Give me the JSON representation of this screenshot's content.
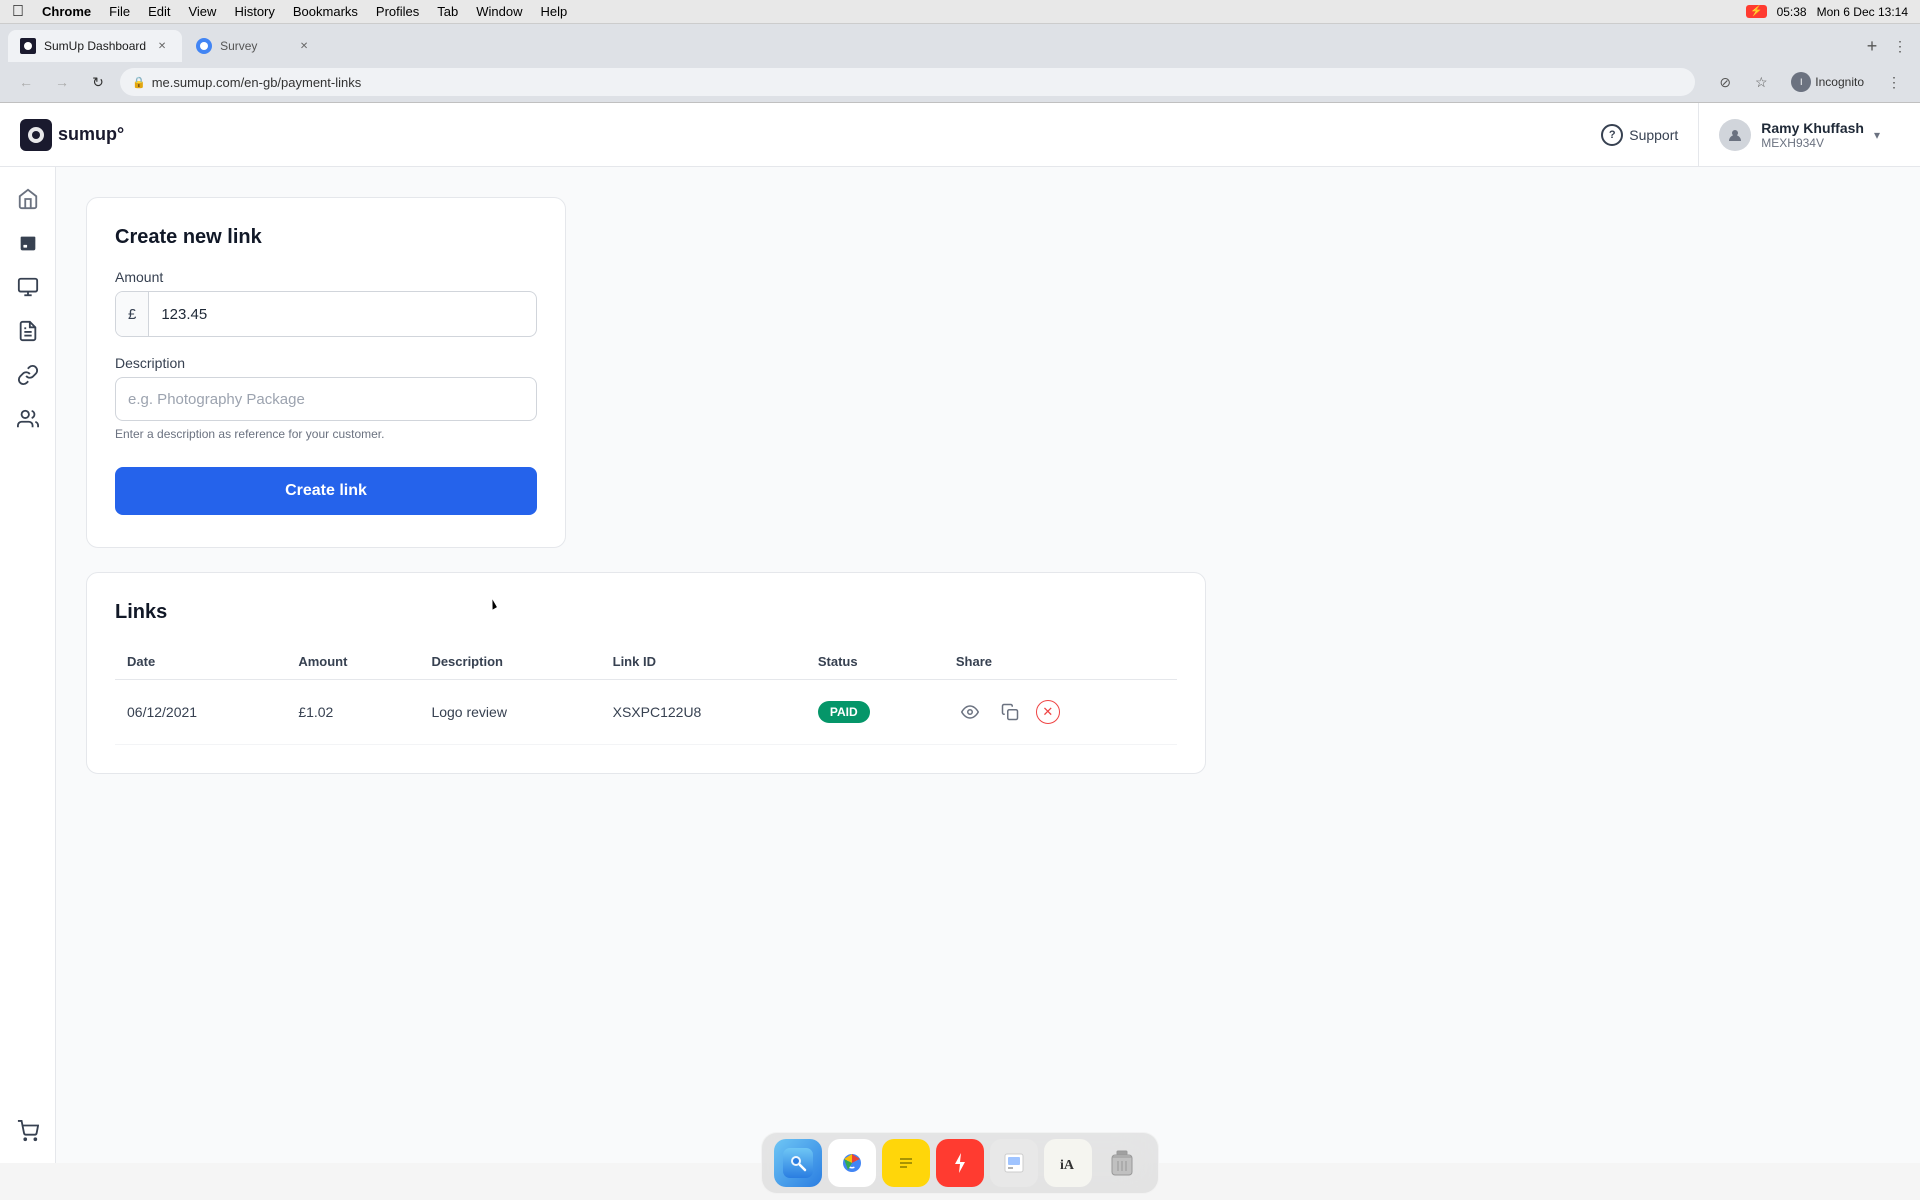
{
  "os": {
    "menubar": {
      "apple": "⌘",
      "app_name": "Chrome",
      "menus": [
        "File",
        "Edit",
        "View",
        "History",
        "Bookmarks",
        "Profiles",
        "Tab",
        "Window",
        "Help"
      ],
      "time": "Mon 6 Dec  13:14",
      "battery_label": "05:38",
      "battery_pct": "⚡"
    }
  },
  "browser": {
    "tabs": [
      {
        "id": "sumup",
        "label": "SumUp Dashboard",
        "active": true,
        "favicon": "S"
      },
      {
        "id": "survey",
        "label": "Survey",
        "active": false,
        "favicon": "○"
      }
    ],
    "address": "me.sumup.com/en-gb/payment-links",
    "profile_label": "Incognito"
  },
  "header": {
    "logo_text": "sumup°",
    "logo_icon": "S",
    "support_label": "Support",
    "user_name": "Ramy Khuffash",
    "user_id": "MEXH934V",
    "chevron": "▾"
  },
  "sidebar": {
    "items": [
      {
        "id": "home",
        "icon": "⌂",
        "label": "Home"
      },
      {
        "id": "card-reader",
        "icon": "⊡",
        "label": "Card Reader"
      },
      {
        "id": "orders",
        "icon": "⊞",
        "label": "Orders"
      },
      {
        "id": "receipts",
        "icon": "≡",
        "label": "Receipts"
      },
      {
        "id": "payment-links",
        "icon": "⊙",
        "label": "Payment Links"
      },
      {
        "id": "customers",
        "icon": "⊛",
        "label": "Customers"
      },
      {
        "id": "shop",
        "icon": "⊕",
        "label": "Shop"
      }
    ]
  },
  "create_form": {
    "title": "Create new link",
    "amount_label": "Amount",
    "currency_symbol": "£",
    "amount_value": "123.45",
    "description_label": "Description",
    "description_placeholder": "e.g. Photography Package",
    "description_hint": "Enter a description as reference for your customer.",
    "create_button_label": "Create link"
  },
  "links_table": {
    "title": "Links",
    "columns": [
      "Date",
      "Amount",
      "Description",
      "Link ID",
      "Status",
      "Share"
    ],
    "rows": [
      {
        "date": "06/12/2021",
        "amount": "£1.02",
        "description": "Logo review",
        "link_id": "XSXPC122U8",
        "status": "PAID",
        "status_color": "#059669"
      }
    ]
  },
  "dock": {
    "items": [
      {
        "id": "finder",
        "icon": "🔍",
        "label": "Finder"
      },
      {
        "id": "chrome",
        "icon": "◉",
        "label": "Chrome"
      },
      {
        "id": "notes",
        "icon": "📝",
        "label": "Notes"
      },
      {
        "id": "reeder",
        "icon": "⚡",
        "label": "Reeder"
      },
      {
        "id": "preview",
        "icon": "▶",
        "label": "Preview"
      },
      {
        "id": "ia",
        "icon": "✏",
        "label": "iA Writer"
      },
      {
        "id": "trash",
        "icon": "🗑",
        "label": "Trash"
      }
    ]
  },
  "icons": {
    "lock": "🔒",
    "eye": "👁",
    "copy": "⧉",
    "close": "✕",
    "question": "?",
    "back": "←",
    "forward": "→",
    "reload": "↻",
    "star": "☆",
    "shield": "⊘",
    "more": "⋮"
  }
}
